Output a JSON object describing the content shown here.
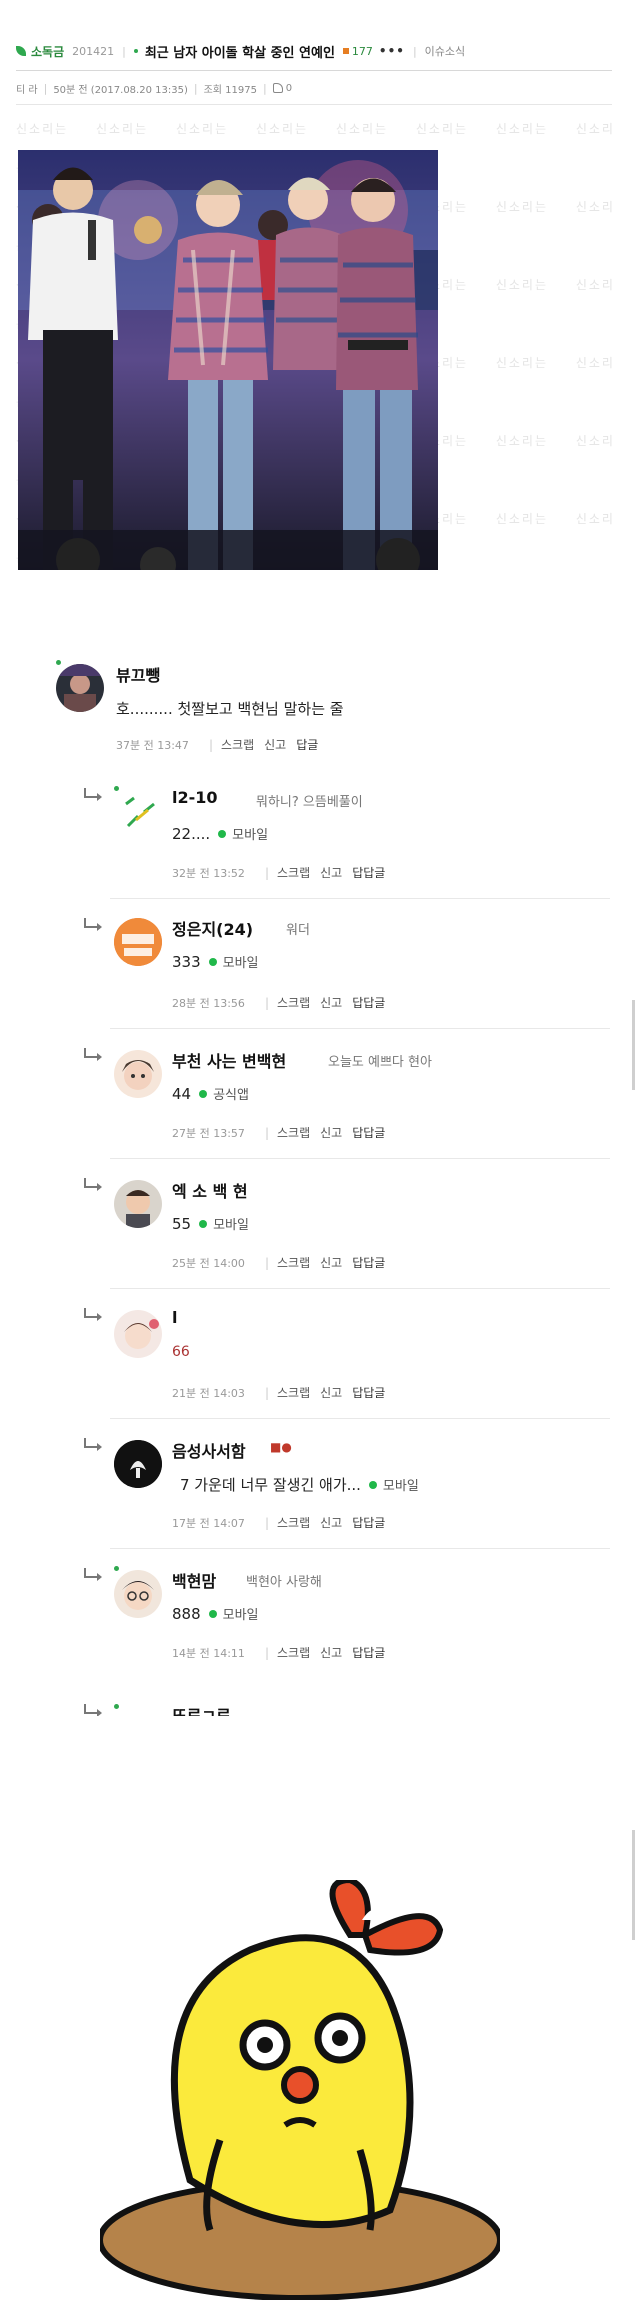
{
  "header": {
    "board_name": "소독금",
    "board_date": "201421",
    "title": "최근 남자 아이돌 학살 중인 연예인",
    "comment_count": "177",
    "more": "•••",
    "category": "이슈소식"
  },
  "meta": {
    "author": "티 라",
    "posted": "50분 전 (2017.08.20 13:35)",
    "views": "조회 11975",
    "likes": "0"
  },
  "watermark_text": "신소리는",
  "comments": [
    {
      "nick": "뷰끄뺑",
      "status": "",
      "text": "호......... 첫짤보고 백현님 말하는 줄",
      "source": "",
      "time": "37분 전 13:47",
      "a1": "스크랩",
      "a2": "신고",
      "a3": "답글"
    },
    {
      "nick": "l2-10",
      "status": "뭐하니? 으뜸베풀이",
      "text": "22....",
      "source": "모바일",
      "time": "32분 전 13:52",
      "a1": "스크랩",
      "a2": "신고",
      "a3": "답답글"
    },
    {
      "nick": "정은지(24)",
      "status": "워더",
      "text": "333",
      "source": "모바일",
      "time": "28분 전 13:56",
      "a1": "스크랩",
      "a2": "신고",
      "a3": "답답글"
    },
    {
      "nick": "부천 사는 변백현",
      "status": "오늘도 예쁘다 현아",
      "text": "44",
      "source": "공식앱",
      "time": "27분 전 13:57",
      "a1": "스크랩",
      "a2": "신고",
      "a3": "답답글"
    },
    {
      "nick": "엑 소 백 현",
      "status": "",
      "text": "55",
      "source": "모바일",
      "time": "25분 전 14:00",
      "a1": "스크랩",
      "a2": "신고",
      "a3": "답답글"
    },
    {
      "nick": "l",
      "status": "",
      "text": "66",
      "source": "",
      "time": "21분 전 14:03",
      "a1": "스크랩",
      "a2": "신고",
      "a3": "답답글"
    },
    {
      "nick": "음성사서함",
      "status": "",
      "text": "7 가운데 너무 잘생긴 애가...",
      "source": "모바일",
      "time": "17분 전 14:07",
      "a1": "스크랩",
      "a2": "신고",
      "a3": "답답글"
    },
    {
      "nick": "백현맘",
      "status": "백현아 사랑해",
      "text": "888",
      "source": "모바일",
      "time": "14분 전 14:11",
      "a1": "스크랩",
      "a2": "신고",
      "a3": "답답글"
    },
    {
      "nick": "뜨로ㄱ로",
      "status": "",
      "text": "",
      "source": "",
      "time": "",
      "a1": "",
      "a2": "",
      "a3": ""
    }
  ],
  "colors": {
    "accent": "#2fa84f",
    "mobile_dot": "#20b84a",
    "character_yellow": "#fbea3c",
    "character_bow": "#e8502a",
    "ground": "#b5834a"
  }
}
